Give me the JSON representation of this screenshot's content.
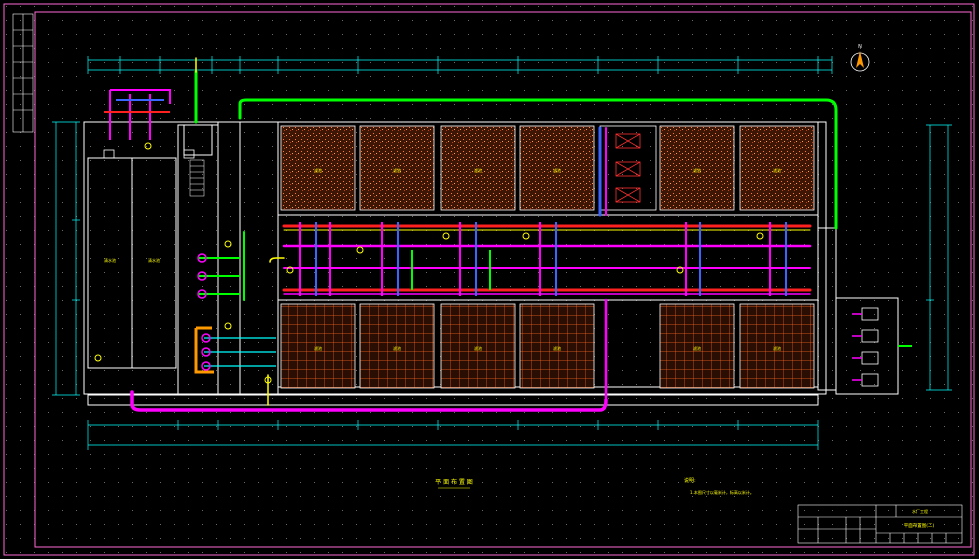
{
  "drawing": {
    "plan_title": "平 面 布 置 图",
    "notes_heading": "说明:",
    "notes": [
      "1.本图尺寸以毫米计，标高以米计。"
    ],
    "north_label": "N"
  },
  "rooms": {
    "top_tanks": [
      "滤池",
      "滤池",
      "滤池",
      "滤池",
      "滤池",
      "滤池"
    ],
    "bottom_tanks": [
      "滤池",
      "滤池",
      "滤池",
      "滤池",
      "滤池",
      "滤池"
    ],
    "left_tanks": [
      "清水池",
      "清水池"
    ]
  },
  "title_block": {
    "title": "平面布置图(二)",
    "project": "水厂工程"
  },
  "colors": {
    "background": "#000000",
    "frame": "#ff6ad5",
    "walls": "#ffffff",
    "dimensions": "#00ffff",
    "grid_dots": "#6a6a6a",
    "pipe_magenta": "#ff00ff",
    "pipe_red": "#ff2020",
    "pipe_green": "#00ff00",
    "pipe_yellow": "#ffff00",
    "pipe_blue": "#3c64ff",
    "pipe_orange": "#ff9900",
    "media_fill": "#4a1a08"
  }
}
